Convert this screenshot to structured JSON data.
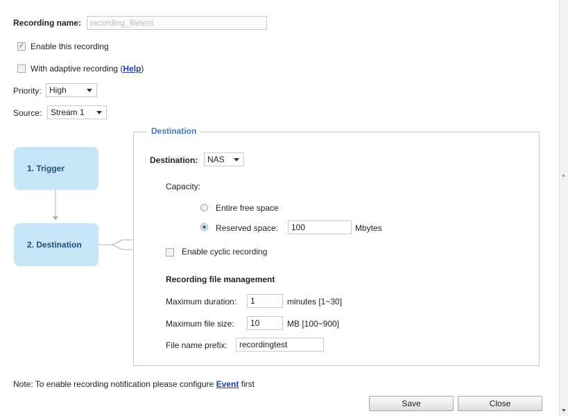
{
  "recording": {
    "name_label": "Recording name:",
    "name_value": "recording_filetest",
    "enable_label": "Enable this recording",
    "adaptive_label": "With adaptive recording (",
    "adaptive_help": "Help",
    "adaptive_suffix": ")",
    "priority_label": "Priority:",
    "priority_value": "High",
    "source_label": "Source:",
    "source_value": "Stream 1"
  },
  "flow": {
    "step1": "1. Trigger",
    "step2": "2. Destination"
  },
  "destination": {
    "legend": "Destination",
    "label": "Destination:",
    "value": "NAS",
    "capacity_label": "Capacity:",
    "entire_free": "Entire free space",
    "reserved_label": "Reserved space:",
    "reserved_value": "100",
    "reserved_unit": "Mbytes",
    "cyclic_label": "Enable cyclic recording"
  },
  "file_mgmt": {
    "heading": "Recording file management",
    "max_duration_label": "Maximum duration:",
    "max_duration_value": "1",
    "max_duration_unit": "minutes [1~30]",
    "max_size_label": "Maximum file size:",
    "max_size_value": "10",
    "max_size_unit": "MB [100~900]",
    "prefix_label": "File name prefix:",
    "prefix_value": "recordingtest"
  },
  "note": {
    "prefix": "Note: To enable recording notification please configure ",
    "link": "Event",
    "suffix": " first"
  },
  "buttons": {
    "save": "Save",
    "close": "Close"
  },
  "colors": {
    "flow_box": "#c6e6f8",
    "legend": "#3a78c9",
    "link": "#1a3fa6"
  }
}
